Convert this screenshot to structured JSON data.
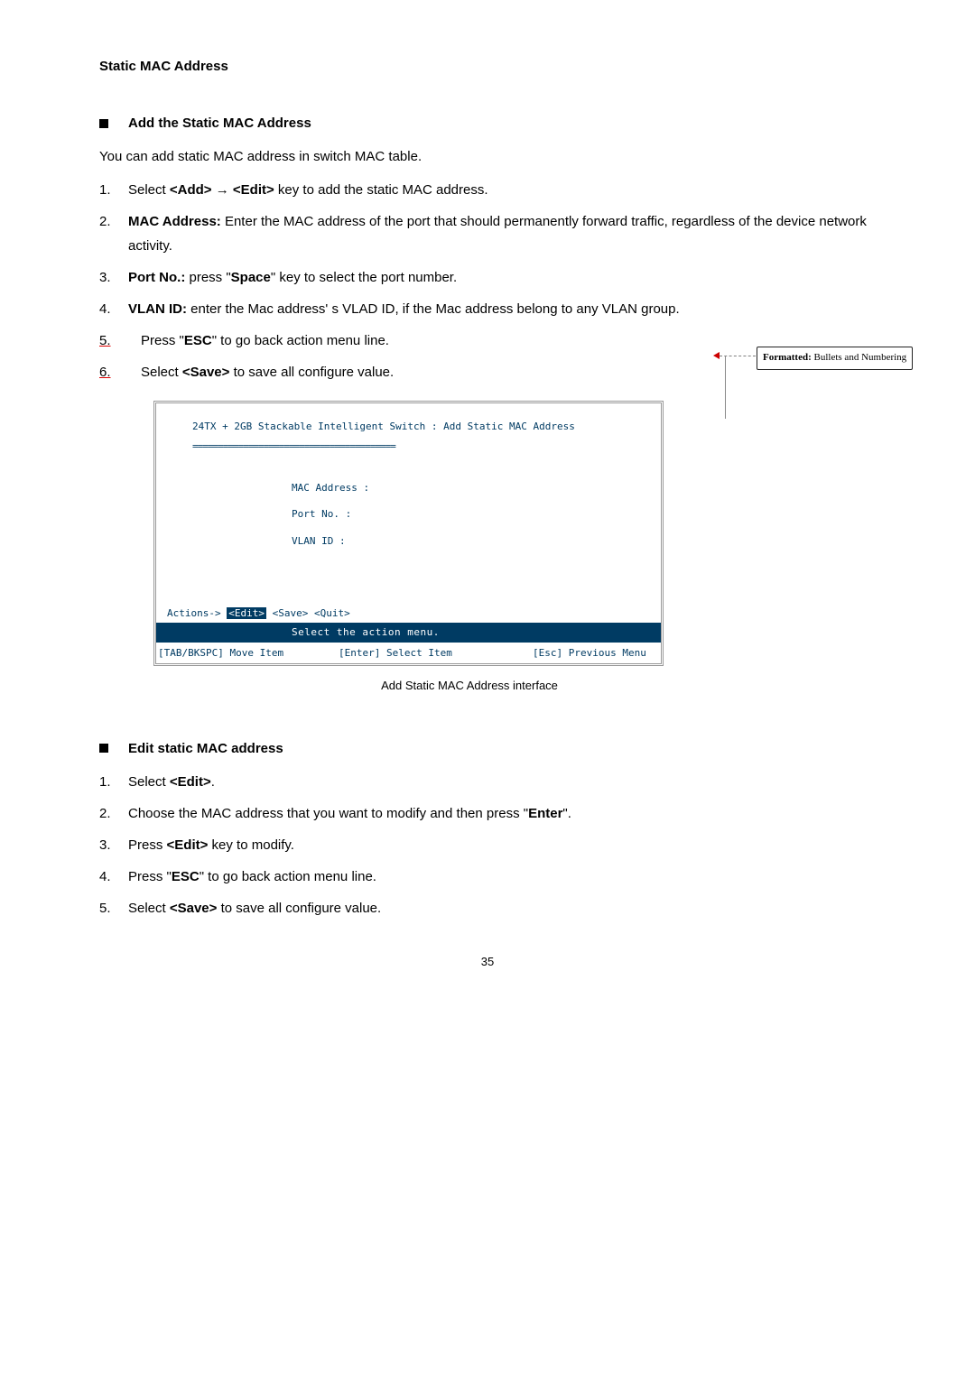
{
  "title": "Static MAC Address",
  "section1": {
    "heading": "Add the Static MAC Address",
    "intro": "You can add static MAC address in switch MAC table.",
    "steps": {
      "n1": "1.",
      "t1_a": "Select ",
      "t1_b": "<Add>",
      "t1_c": " → ",
      "t1_d": "<Edit>",
      "t1_e": " key to add the static MAC address.",
      "n2": "2.",
      "t2_a": "MAC Address:",
      "t2_b": " Enter the MAC address of the port that should permanently forward traffic, regardless of the device network activity.",
      "n3": "3.",
      "t3_a": "Port No.:",
      "t3_b": " press \"",
      "t3_c": "Space",
      "t3_d": "\" key to select the port number.",
      "n4": "4.",
      "t4_a": "VLAN ID:",
      "t4_b": " enter the Mac address' s VLAD ID, if the Mac address belong to any VLAN group.",
      "n5": "5.   ",
      "t5_a": "Press \"",
      "t5_b": "ESC",
      "t5_c": "\" to go back action menu line.",
      "n6": "6.   ",
      "t6_a": "Select ",
      "t6_b": "<Save>",
      "t6_c": " to save all configure value."
    }
  },
  "terminal": {
    "title": "24TX + 2GB Stackable Intelligent Switch : Add Static MAC Address",
    "divider": "========================================",
    "field1": "MAC Address :",
    "field2": "Port No.    :",
    "field3": "VLAN ID     :",
    "actions_prefix": "Actions->   ",
    "edit": "<Edit>",
    "save": "  <Save>   ",
    "quit": "<Quit>",
    "darkbar": "Select the action menu.",
    "footer1": "[TAB/BKSPC] Move Item",
    "footer2": "[Enter] Select Item",
    "footer3": "[Esc] Previous Menu"
  },
  "caption": "Add Static MAC Address interface",
  "section2": {
    "heading": "Edit static MAC address",
    "steps": {
      "n1": "1.",
      "t1_a": "Select ",
      "t1_b": "<Edit>",
      "t1_c": ".",
      "n2": "2.",
      "t2_a": "Choose the MAC address that you want to modify and then press \"",
      "t2_b": "Enter",
      "t2_c": "\".",
      "n3": "3.",
      "t3_a": "Press ",
      "t3_b": "<Edit>",
      "t3_c": " key to modify.",
      "n4": "4.",
      "t4_a": "Press \"",
      "t4_b": "ESC",
      "t4_c": "\" to go back action menu line.",
      "n5": "5.",
      "t5_a": "Select ",
      "t5_b": "<Save>",
      "t5_c": " to save all configure value."
    }
  },
  "comment": {
    "label": "Formatted:",
    "text": " Bullets and Numbering"
  },
  "page_number": "35"
}
